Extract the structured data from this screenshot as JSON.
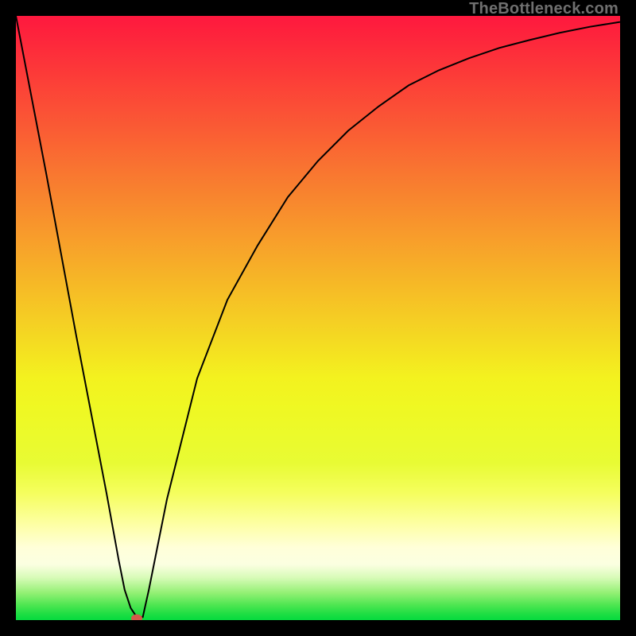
{
  "watermark": "TheBottleneck.com",
  "chart_data": {
    "type": "line",
    "title": "",
    "xlabel": "",
    "ylabel": "",
    "xlim": [
      0,
      100
    ],
    "ylim": [
      0,
      100
    ],
    "x": [
      0,
      5,
      10,
      15,
      17,
      18,
      19,
      20,
      21,
      22,
      25,
      30,
      35,
      40,
      45,
      50,
      55,
      60,
      65,
      70,
      75,
      80,
      85,
      90,
      95,
      100
    ],
    "values": [
      100,
      74,
      47,
      21,
      10,
      5,
      2,
      0.5,
      0.5,
      5,
      20,
      40,
      53,
      62,
      70,
      76,
      81,
      85,
      88.5,
      91,
      93,
      94.7,
      96,
      97.2,
      98.2,
      99
    ],
    "marker": {
      "x": 20,
      "y": 0.3,
      "color": "#d45a4a"
    },
    "gradient_stops": [
      {
        "offset": 0.0,
        "color": "#fe183e"
      },
      {
        "offset": 0.05,
        "color": "#fd2a3b"
      },
      {
        "offset": 0.1,
        "color": "#fc3c38"
      },
      {
        "offset": 0.15,
        "color": "#fb4e36"
      },
      {
        "offset": 0.2,
        "color": "#fa6033"
      },
      {
        "offset": 0.25,
        "color": "#f97331"
      },
      {
        "offset": 0.3,
        "color": "#f8852e"
      },
      {
        "offset": 0.35,
        "color": "#f8972c"
      },
      {
        "offset": 0.4,
        "color": "#f7a929"
      },
      {
        "offset": 0.45,
        "color": "#f6bb26"
      },
      {
        "offset": 0.5,
        "color": "#f5cd24"
      },
      {
        "offset": 0.55,
        "color": "#f4df21"
      },
      {
        "offset": 0.6,
        "color": "#f3f21f"
      },
      {
        "offset": 0.65,
        "color": "#eff823"
      },
      {
        "offset": 0.7,
        "color": "#ebfa2c"
      },
      {
        "offset": 0.74,
        "color": "#e8fb34"
      },
      {
        "offset": 0.79,
        "color": "#f5fe5e"
      },
      {
        "offset": 0.84,
        "color": "#fdffa2"
      },
      {
        "offset": 0.88,
        "color": "#ffffd9"
      },
      {
        "offset": 0.908,
        "color": "#fbffe1"
      },
      {
        "offset": 0.93,
        "color": "#d7fbb7"
      },
      {
        "offset": 0.955,
        "color": "#93f074"
      },
      {
        "offset": 0.975,
        "color": "#4ee651"
      },
      {
        "offset": 0.99,
        "color": "#1ede43"
      },
      {
        "offset": 1.0,
        "color": "#05da3e"
      }
    ]
  }
}
